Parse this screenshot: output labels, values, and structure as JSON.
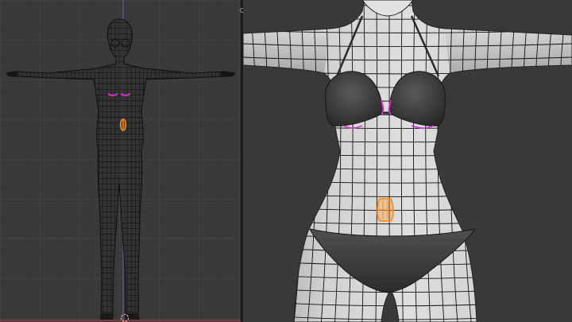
{
  "app": {
    "name": "blender-3d-viewport-split"
  },
  "viewports": [
    {
      "id": "left",
      "view": "front-orthographic",
      "mode": "edit-mesh"
    },
    {
      "id": "right",
      "view": "front-orthographic-zoomed",
      "mode": "edit-mesh"
    }
  ],
  "colors": {
    "background": "#393939",
    "grid_minor": "#424242",
    "grid_major": "#4a4a4a",
    "wire": "#101010",
    "mesh_surface": "#c8c8c8",
    "clothing": "#3a3a3a",
    "selected": "#ff8c1a",
    "seam": "#d22ec8",
    "axis_z": "#5a7fc8",
    "axis_x": "#b0444f"
  },
  "icons": {
    "cursor": "3d-cursor-icon",
    "split": "area-split-icon"
  }
}
